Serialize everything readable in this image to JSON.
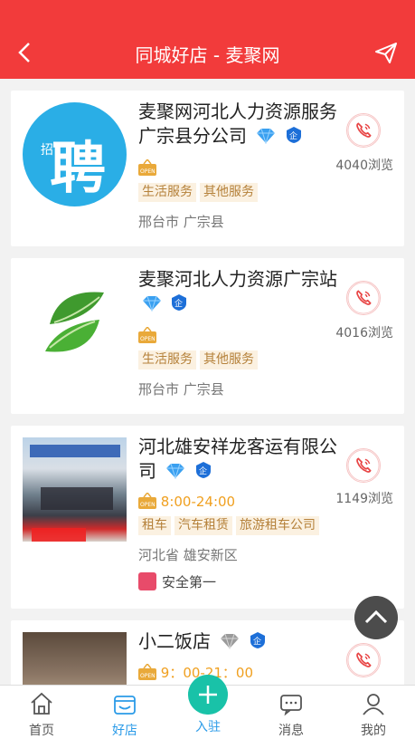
{
  "header": {
    "title": "同城好店 - 麦聚网"
  },
  "cards": [
    {
      "name": "麦聚网河北人力资源服务广宗县分公司",
      "logo_text": "聘",
      "logo_small": "招",
      "hours": "",
      "tags": [
        "生活服务",
        "其他服务"
      ],
      "location": "邢台市 广宗县",
      "views": "4040浏览",
      "diamond": "blue"
    },
    {
      "name": "麦聚河北人力资源广宗站",
      "hours": "",
      "tags": [
        "生活服务",
        "其他服务"
      ],
      "location": "邢台市 广宗县",
      "views": "4016浏览",
      "diamond": "blue"
    },
    {
      "name": "河北雄安祥龙客运有限公司",
      "hours": "8:00-24:00",
      "tags": [
        "租车",
        "汽车租赁",
        "旅游租车公司"
      ],
      "location": "河北省 雄安新区",
      "views": "1149浏览",
      "extra": "安全第一",
      "diamond": "blue"
    },
    {
      "name": "小二饭店",
      "hours": "9：00-21：00",
      "tags": [],
      "location": "",
      "views": "",
      "diamond": "grey"
    }
  ],
  "tabbar": [
    {
      "label": "首页",
      "icon": "home-icon"
    },
    {
      "label": "好店",
      "icon": "shop-icon",
      "active": true
    },
    {
      "label": "入驻",
      "icon": "plus-icon"
    },
    {
      "label": "消息",
      "icon": "message-icon"
    },
    {
      "label": "我的",
      "icon": "user-icon"
    }
  ],
  "colors": {
    "brand": "#f23b3b",
    "tab_active": "#2b9be8",
    "plus": "#19c2a8"
  }
}
